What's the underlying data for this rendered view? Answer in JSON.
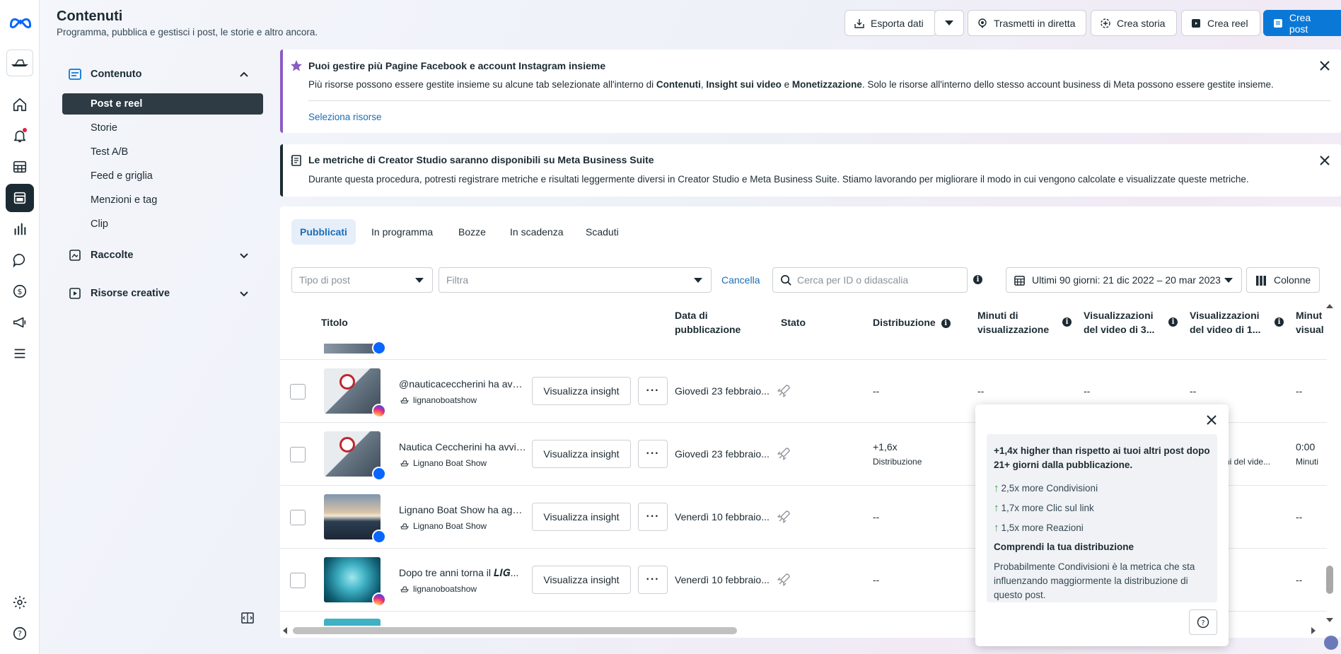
{
  "header": {
    "title": "Contenuti",
    "subtitle": "Programma, pubblica e gestisci i post, le storie e altro ancora."
  },
  "toolbar": {
    "export_label": "Esporta dati",
    "live_label": "Trasmetti in diretta",
    "story_label": "Crea storia",
    "reel_label": "Crea reel",
    "post_label": "Crea post"
  },
  "sidebar": {
    "content_label": "Contenuto",
    "items": [
      {
        "label": "Post e reel",
        "active": true
      },
      {
        "label": "Storie"
      },
      {
        "label": "Test A/B"
      },
      {
        "label": "Feed e griglia"
      },
      {
        "label": "Menzioni e tag"
      },
      {
        "label": "Clip"
      }
    ],
    "collections_label": "Raccolte",
    "creative_label": "Risorse creative"
  },
  "banner1": {
    "title": "Puoi gestire più Pagine Facebook e account Instagram insieme",
    "text_pre": "Più risorse possono essere gestite insieme su alcune tab selezionate all'interno di ",
    "b1": "Contenuti",
    "sep1": ", ",
    "b2": "Insight sui video",
    "sep2": " e ",
    "b3": "Monetizzazione",
    "text_post": ". Solo le risorse all'interno dello stesso account business di Meta possono essere gestite insieme.",
    "link": "Seleziona risorse",
    "accent": "#8b5cc4"
  },
  "banner2": {
    "title": "Le metriche di Creator Studio saranno disponibili su Meta Business Suite",
    "text": "Durante questa procedura, potresti registrare metriche e risultati leggermente diversi in Creator Studio e Meta Business Suite. Stiamo lavorando per migliorare il modo in cui vengono calcolate e visualizzate queste metriche.",
    "accent": "#1c2b33"
  },
  "tabs": [
    {
      "label": "Pubblicati",
      "active": true
    },
    {
      "label": "In programma"
    },
    {
      "label": "Bozze"
    },
    {
      "label": "In scadenza"
    },
    {
      "label": "Scaduti"
    }
  ],
  "filters": {
    "post_type_placeholder": "Tipo di post",
    "filter_placeholder": "Filtra",
    "cancel_label": "Cancella",
    "search_placeholder": "Cerca per ID o didascalia",
    "date_range": "Ultimi 90 giorni: 21 dic 2022 – 20 mar 2023",
    "columns_label": "Colonne"
  },
  "table": {
    "headers": {
      "title": "Titolo",
      "date_l1": "Data di",
      "date_l2": "pubblicazione",
      "status": "Stato",
      "distribution": "Distribuzione",
      "minutes_l1": "Minuti di",
      "minutes_l2": "visualizzazione",
      "views3_l1": "Visualizzazioni",
      "views3_l2": "del video di 3...",
      "views1_l1": "Visualizzazioni",
      "views1_l2": "del video di 1...",
      "last_l1": "Minut",
      "last_l2": "visual"
    },
    "rows": [
      {
        "title": "@nauticaceccherini ha avvi...",
        "account": "lignanoboatshow",
        "platform": "instagram",
        "date": "Giovedì 23 febbraio...",
        "distribution": "--",
        "c1": "--",
        "c2": "--",
        "c3": "--",
        "c4": "--"
      },
      {
        "title": "Nautica Ceccherini ha avvia...",
        "account": "Lignano Boat Show",
        "platform": "facebook",
        "date": "Giovedì 23 febbraio...",
        "distribution": "+1,6x",
        "distribution_sub": "Distribuzione",
        "c3": "ni del vide...",
        "c4": "0:00",
        "c4_sub": "Minuti"
      },
      {
        "title": "Lignano Boat Show ha aggi...",
        "account": "Lignano Boat Show",
        "platform": "facebook",
        "date": "Venerdì 10 febbraio...",
        "distribution": "--",
        "c4": "--"
      },
      {
        "title": "Dopo tre anni torna il 𝑳𝑰𝑮...",
        "account": "lignanoboatshow",
        "platform": "instagram",
        "date": "Venerdì 10 febbraio...",
        "distribution": "--",
        "c4": "--"
      }
    ],
    "insight_label": "Visualizza insight",
    "more_label": "···"
  },
  "popup": {
    "headline": "+1,4x higher than rispetto ai tuoi altri post dopo 21+ giorni dalla pubblicazione.",
    "metrics": [
      "2,5x more Condivisioni",
      "1,7x more Clic sul link",
      "1,5x more Reazioni"
    ],
    "subtitle": "Comprendi la tua distribuzione",
    "description": "Probabilmente Condivisioni è la metrica che sta influenzando maggiormente la distribuzione di questo post."
  },
  "colors": {
    "accent": "#0a78d7",
    "brand_meta": "#0866ff",
    "positive": "#31a24c"
  }
}
